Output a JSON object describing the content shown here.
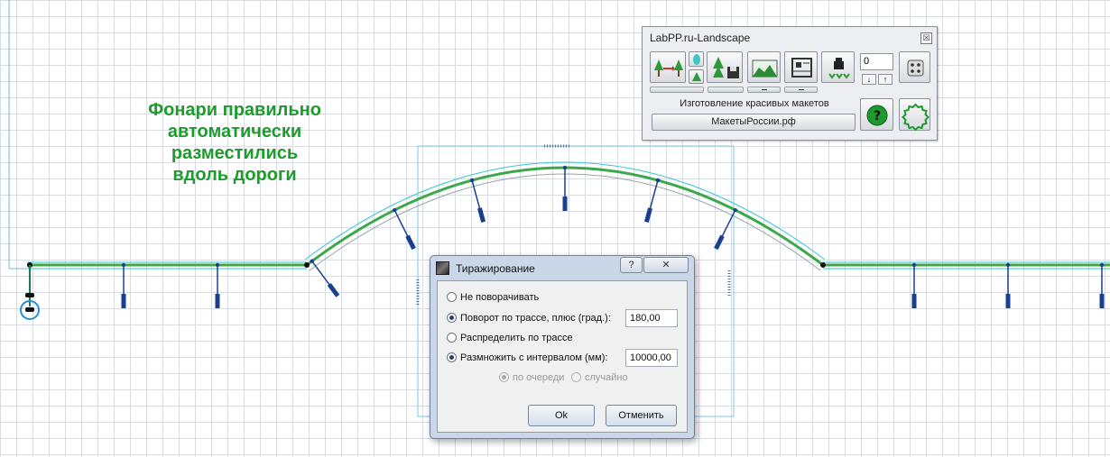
{
  "canvas": {
    "annotation_lines": [
      "Фонари правильно",
      "автоматически",
      "разместились",
      "вдоль дороги"
    ],
    "colors": {
      "road_green": "#3ca84a",
      "road_cyan": "#35c6cf",
      "lamp_blue": "#1b3f8f",
      "annotation_green": "#1f9a2c"
    }
  },
  "palette": {
    "title": "LabPP.ru-Landscape",
    "close_icon": "close-icon",
    "number_value": "0",
    "caption": "Изготовление красивых макетов",
    "site_button": "МакетыРоссии.рф",
    "icons": [
      "trees-move-icon",
      "tree-type-icon",
      "tree-save-icon",
      "landscape-icon",
      "frame-icon",
      "weight-icon",
      "dice-icon",
      "help-icon",
      "gear-icon"
    ]
  },
  "dialog": {
    "title": "Тиражирование",
    "help": "?",
    "close": "✕",
    "options": [
      {
        "label": "Не поворачивать",
        "selected": false
      },
      {
        "label": "Поворот по трассе, плюс (град.):",
        "selected": true,
        "value": "180,00"
      },
      {
        "label": "Распределить по трассе",
        "selected": false
      },
      {
        "label": "Размножить с интервалом (мм):",
        "selected": true,
        "value": "10000,00"
      }
    ],
    "sub_options": [
      {
        "label": "по очереди",
        "selected": true
      },
      {
        "label": "случайно",
        "selected": false
      }
    ],
    "ok": "Ok",
    "cancel": "Отменить"
  }
}
